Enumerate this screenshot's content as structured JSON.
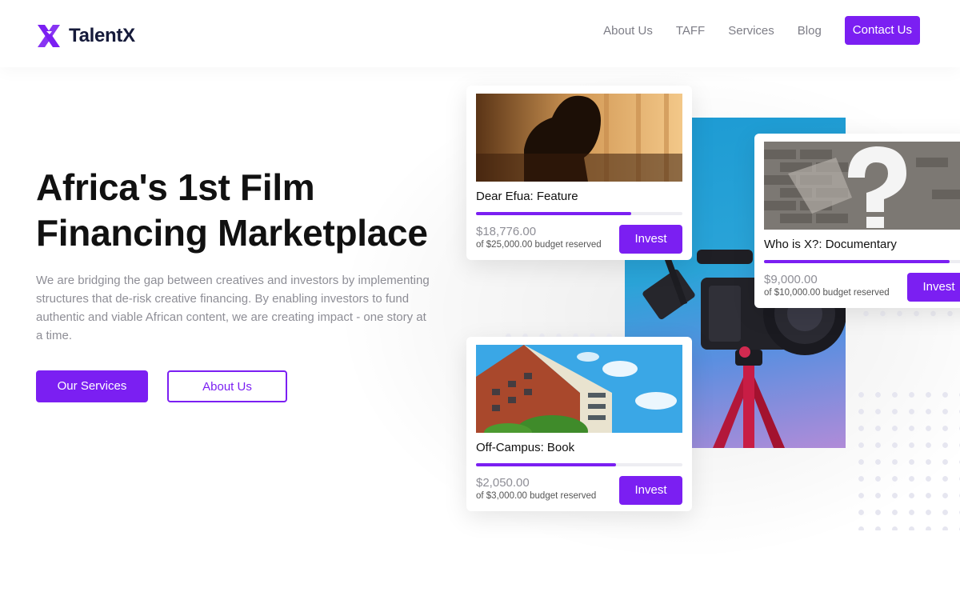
{
  "brand": {
    "name": "TalentX",
    "accent": "#7b1ff2"
  },
  "nav": {
    "items": [
      "About Us",
      "TAFF",
      "Services",
      "Blog"
    ],
    "cta": "Contact Us"
  },
  "hero": {
    "title_line1": "Africa's 1st Film",
    "title_line2": "Financing Marketplace",
    "description": "We are bridging the gap between creatives and investors by implementing structures that de-risk creative financing. By enabling investors to fund authentic and viable African content, we are creating impact - one story at a time.",
    "primary_button": "Our Services",
    "secondary_button": "About Us"
  },
  "projects": [
    {
      "title": "Dear Efua: Feature",
      "raised": "$18,776.00",
      "budget": "of $25,000.00 budget reserved",
      "progress": 0.75,
      "cta": "Invest"
    },
    {
      "title": "Who is X?: Documentary",
      "raised": "$9,000.00",
      "budget": "of $10,000.00 budget reserved",
      "progress": 0.9,
      "cta": "Invest"
    },
    {
      "title": "Off-Campus: Book",
      "raised": "$2,050.00",
      "budget": "of $3,000.00 budget reserved",
      "progress": 0.68,
      "cta": "Invest"
    }
  ]
}
